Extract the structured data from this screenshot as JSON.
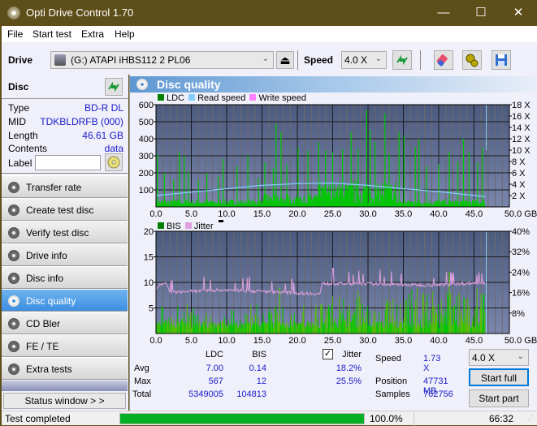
{
  "window": {
    "title": "Opti Drive Control 1.70",
    "minimize": "—",
    "maximize": "☐",
    "close": "✕"
  },
  "menu": [
    "File",
    "Start test",
    "Extra",
    "Help"
  ],
  "toolbar": {
    "drive_label": "Drive",
    "drive_value": "(G:)  ATAPI iHBS112  2 PL06",
    "speed_label": "Speed",
    "speed_value": "4.0 X",
    "eject_icon": "⏏"
  },
  "disc": {
    "header": "Disc",
    "rows": [
      {
        "label": "Type",
        "value": "BD-R DL"
      },
      {
        "label": "MID",
        "value": "TDKBLDRFB (000)"
      },
      {
        "label": "Length",
        "value": "46.61 GB"
      },
      {
        "label": "Contents",
        "value": "data"
      }
    ],
    "label_field": "Label",
    "label_value": ""
  },
  "nav": [
    {
      "label": "Transfer rate",
      "active": false
    },
    {
      "label": "Create test disc",
      "active": false
    },
    {
      "label": "Verify test disc",
      "active": false
    },
    {
      "label": "Drive info",
      "active": false
    },
    {
      "label": "Disc info",
      "active": false
    },
    {
      "label": "Disc quality",
      "active": true
    },
    {
      "label": "CD Bler",
      "active": false
    },
    {
      "label": "FE / TE",
      "active": false
    },
    {
      "label": "Extra tests",
      "active": false
    }
  ],
  "status_window_button": "Status window > >",
  "panel": {
    "title": "Disc quality"
  },
  "chart_data": [
    {
      "type": "bar",
      "title": "LDC / Read speed",
      "legend": [
        "LDC",
        "Read speed",
        "Write speed"
      ],
      "legend_colors": {
        "LDC": "#008000",
        "Read speed": "#87cefa",
        "Write speed": "#ff80ff"
      },
      "x_ticks": [
        "0.0",
        "5.0",
        "10.0",
        "15.0",
        "20.0",
        "25.0",
        "30.0",
        "35.0",
        "40.0",
        "45.0",
        "50.0 GB"
      ],
      "xlim": [
        0,
        50
      ],
      "y_ticks_left": [
        "100",
        "200",
        "300",
        "400",
        "500",
        "600"
      ],
      "ylim_left": [
        0,
        600
      ],
      "y_ticks_right": [
        "2 X",
        "4 X",
        "6 X",
        "8 X",
        "10 X",
        "12 X",
        "14 X",
        "16 X",
        "18 X"
      ],
      "ylim_right": [
        0,
        18
      ],
      "data_end_gb": 46.61,
      "ldc_peaks": [
        [
          0.2,
          310
        ],
        [
          1.2,
          200
        ],
        [
          2.5,
          160
        ],
        [
          3.3,
          320
        ],
        [
          4.0,
          300
        ],
        [
          4.6,
          210
        ],
        [
          6.0,
          160
        ],
        [
          7.2,
          200
        ],
        [
          8.8,
          180
        ],
        [
          9.5,
          280
        ],
        [
          11.5,
          240
        ],
        [
          13.0,
          300
        ],
        [
          14.5,
          170
        ],
        [
          15.4,
          260
        ],
        [
          16.6,
          230
        ],
        [
          17.0,
          490
        ],
        [
          17.7,
          440
        ],
        [
          18.5,
          250
        ],
        [
          20.1,
          350
        ],
        [
          21.5,
          330
        ],
        [
          23.0,
          380
        ],
        [
          24.0,
          330
        ],
        [
          25.0,
          320
        ],
        [
          26.4,
          340
        ],
        [
          27.6,
          440
        ],
        [
          28.6,
          340
        ],
        [
          29.8,
          570
        ],
        [
          30.3,
          450
        ],
        [
          31.0,
          380
        ],
        [
          32.4,
          550
        ],
        [
          33.0,
          310
        ],
        [
          34.4,
          440
        ],
        [
          35.1,
          420
        ],
        [
          36.7,
          350
        ],
        [
          37.2,
          400
        ],
        [
          38.3,
          240
        ],
        [
          40.0,
          250
        ],
        [
          41.5,
          320
        ],
        [
          42.7,
          270
        ],
        [
          43.5,
          400
        ],
        [
          44.3,
          320
        ],
        [
          45.5,
          260
        ],
        [
          46.2,
          350
        ]
      ],
      "read_speed_x": [
        [
          0,
          2.0
        ],
        [
          5,
          2.6
        ],
        [
          10,
          3.2
        ],
        [
          15,
          3.8
        ],
        [
          20,
          4.1
        ],
        [
          25,
          4.2
        ],
        [
          30,
          3.8
        ],
        [
          35,
          3.2
        ],
        [
          40,
          2.7
        ],
        [
          46.6,
          1.8
        ]
      ]
    },
    {
      "type": "bar",
      "title": "BIS / Jitter",
      "legend": [
        "BIS",
        "Jitter"
      ],
      "legend_colors": {
        "BIS": "#008000",
        "Jitter": "#dda0dd"
      },
      "x_ticks": [
        "0.0",
        "5.0",
        "10.0",
        "15.0",
        "20.0",
        "25.0",
        "30.0",
        "35.0",
        "40.0",
        "45.0",
        "50.0 GB"
      ],
      "xlim": [
        0,
        50
      ],
      "y_ticks_left": [
        "5",
        "10",
        "15",
        "20"
      ],
      "ylim_left": [
        0,
        20
      ],
      "y_ticks_right": [
        "8%",
        "16%",
        "24%",
        "32%",
        "40%"
      ],
      "ylim_right": [
        0,
        40
      ],
      "data_end_gb": 46.61,
      "jitter_percent": [
        [
          0,
          17.5
        ],
        [
          0.5,
          19
        ],
        [
          1.5,
          19.5
        ],
        [
          2,
          16
        ],
        [
          5,
          16.5
        ],
        [
          10,
          17
        ],
        [
          15,
          16.5
        ],
        [
          20,
          15.8
        ],
        [
          23.2,
          15.5
        ],
        [
          23.5,
          19.5
        ],
        [
          30,
          19.5
        ],
        [
          35,
          19
        ],
        [
          40,
          19
        ],
        [
          46.6,
          20
        ]
      ],
      "bis_max": 12
    }
  ],
  "stats": {
    "col_ldc": "LDC",
    "col_bis": "BIS",
    "jitter_checkbox": "Jitter",
    "jitter_checked": true,
    "rows": [
      {
        "label": "Avg",
        "ldc": "7.00",
        "bis": "0.14",
        "jitter": "18.2%"
      },
      {
        "label": "Max",
        "ldc": "567",
        "bis": "12",
        "jitter": "25.5%"
      },
      {
        "label": "Total",
        "ldc": "5349005",
        "bis": "104813",
        "jitter": ""
      }
    ],
    "speed_label": "Speed",
    "speed_value": "1.73 X",
    "position_label": "Position",
    "position_value": "47731 MB",
    "samples_label": "Samples",
    "samples_value": "762756",
    "speed_select": "4.0 X",
    "start_full": "Start full",
    "start_part": "Start part"
  },
  "statusbar": {
    "text": "Test completed",
    "progress": 100.0,
    "progress_label": "100.0%",
    "time": "66:32"
  }
}
